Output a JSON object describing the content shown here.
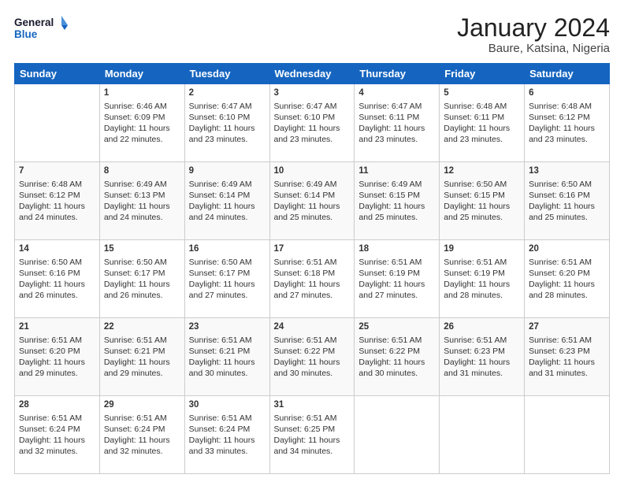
{
  "header": {
    "logo_line1": "General",
    "logo_line2": "Blue",
    "month": "January 2024",
    "location": "Baure, Katsina, Nigeria"
  },
  "columns": [
    "Sunday",
    "Monday",
    "Tuesday",
    "Wednesday",
    "Thursday",
    "Friday",
    "Saturday"
  ],
  "weeks": [
    [
      {
        "day": "",
        "info": ""
      },
      {
        "day": "1",
        "info": "Sunrise: 6:46 AM\nSunset: 6:09 PM\nDaylight: 11 hours\nand 22 minutes."
      },
      {
        "day": "2",
        "info": "Sunrise: 6:47 AM\nSunset: 6:10 PM\nDaylight: 11 hours\nand 23 minutes."
      },
      {
        "day": "3",
        "info": "Sunrise: 6:47 AM\nSunset: 6:10 PM\nDaylight: 11 hours\nand 23 minutes."
      },
      {
        "day": "4",
        "info": "Sunrise: 6:47 AM\nSunset: 6:11 PM\nDaylight: 11 hours\nand 23 minutes."
      },
      {
        "day": "5",
        "info": "Sunrise: 6:48 AM\nSunset: 6:11 PM\nDaylight: 11 hours\nand 23 minutes."
      },
      {
        "day": "6",
        "info": "Sunrise: 6:48 AM\nSunset: 6:12 PM\nDaylight: 11 hours\nand 23 minutes."
      }
    ],
    [
      {
        "day": "7",
        "info": "Sunrise: 6:48 AM\nSunset: 6:12 PM\nDaylight: 11 hours\nand 24 minutes."
      },
      {
        "day": "8",
        "info": "Sunrise: 6:49 AM\nSunset: 6:13 PM\nDaylight: 11 hours\nand 24 minutes."
      },
      {
        "day": "9",
        "info": "Sunrise: 6:49 AM\nSunset: 6:14 PM\nDaylight: 11 hours\nand 24 minutes."
      },
      {
        "day": "10",
        "info": "Sunrise: 6:49 AM\nSunset: 6:14 PM\nDaylight: 11 hours\nand 25 minutes."
      },
      {
        "day": "11",
        "info": "Sunrise: 6:49 AM\nSunset: 6:15 PM\nDaylight: 11 hours\nand 25 minutes."
      },
      {
        "day": "12",
        "info": "Sunrise: 6:50 AM\nSunset: 6:15 PM\nDaylight: 11 hours\nand 25 minutes."
      },
      {
        "day": "13",
        "info": "Sunrise: 6:50 AM\nSunset: 6:16 PM\nDaylight: 11 hours\nand 25 minutes."
      }
    ],
    [
      {
        "day": "14",
        "info": "Sunrise: 6:50 AM\nSunset: 6:16 PM\nDaylight: 11 hours\nand 26 minutes."
      },
      {
        "day": "15",
        "info": "Sunrise: 6:50 AM\nSunset: 6:17 PM\nDaylight: 11 hours\nand 26 minutes."
      },
      {
        "day": "16",
        "info": "Sunrise: 6:50 AM\nSunset: 6:17 PM\nDaylight: 11 hours\nand 27 minutes."
      },
      {
        "day": "17",
        "info": "Sunrise: 6:51 AM\nSunset: 6:18 PM\nDaylight: 11 hours\nand 27 minutes."
      },
      {
        "day": "18",
        "info": "Sunrise: 6:51 AM\nSunset: 6:19 PM\nDaylight: 11 hours\nand 27 minutes."
      },
      {
        "day": "19",
        "info": "Sunrise: 6:51 AM\nSunset: 6:19 PM\nDaylight: 11 hours\nand 28 minutes."
      },
      {
        "day": "20",
        "info": "Sunrise: 6:51 AM\nSunset: 6:20 PM\nDaylight: 11 hours\nand 28 minutes."
      }
    ],
    [
      {
        "day": "21",
        "info": "Sunrise: 6:51 AM\nSunset: 6:20 PM\nDaylight: 11 hours\nand 29 minutes."
      },
      {
        "day": "22",
        "info": "Sunrise: 6:51 AM\nSunset: 6:21 PM\nDaylight: 11 hours\nand 29 minutes."
      },
      {
        "day": "23",
        "info": "Sunrise: 6:51 AM\nSunset: 6:21 PM\nDaylight: 11 hours\nand 30 minutes."
      },
      {
        "day": "24",
        "info": "Sunrise: 6:51 AM\nSunset: 6:22 PM\nDaylight: 11 hours\nand 30 minutes."
      },
      {
        "day": "25",
        "info": "Sunrise: 6:51 AM\nSunset: 6:22 PM\nDaylight: 11 hours\nand 30 minutes."
      },
      {
        "day": "26",
        "info": "Sunrise: 6:51 AM\nSunset: 6:23 PM\nDaylight: 11 hours\nand 31 minutes."
      },
      {
        "day": "27",
        "info": "Sunrise: 6:51 AM\nSunset: 6:23 PM\nDaylight: 11 hours\nand 31 minutes."
      }
    ],
    [
      {
        "day": "28",
        "info": "Sunrise: 6:51 AM\nSunset: 6:24 PM\nDaylight: 11 hours\nand 32 minutes."
      },
      {
        "day": "29",
        "info": "Sunrise: 6:51 AM\nSunset: 6:24 PM\nDaylight: 11 hours\nand 32 minutes."
      },
      {
        "day": "30",
        "info": "Sunrise: 6:51 AM\nSunset: 6:24 PM\nDaylight: 11 hours\nand 33 minutes."
      },
      {
        "day": "31",
        "info": "Sunrise: 6:51 AM\nSunset: 6:25 PM\nDaylight: 11 hours\nand 34 minutes."
      },
      {
        "day": "",
        "info": ""
      },
      {
        "day": "",
        "info": ""
      },
      {
        "day": "",
        "info": ""
      }
    ]
  ]
}
